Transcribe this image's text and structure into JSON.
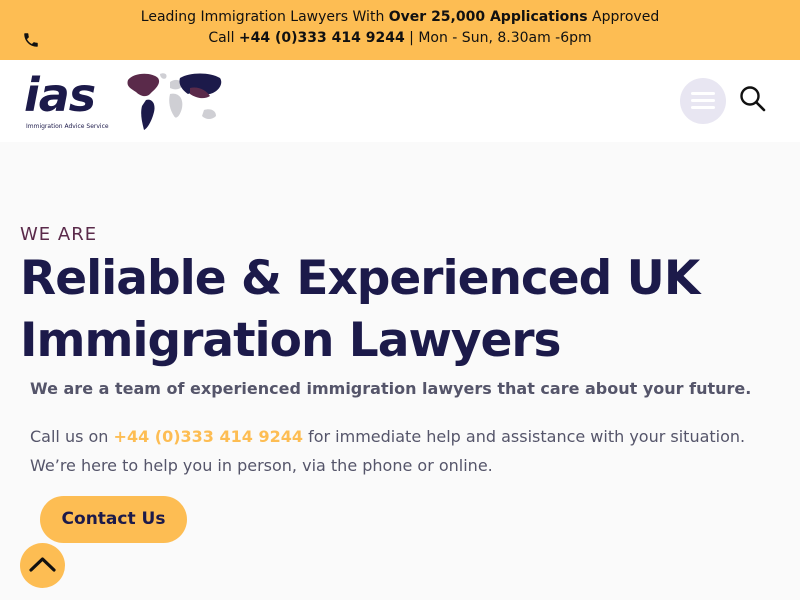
{
  "topbar": {
    "line1_prefix": "Leading Immigration Lawyers With ",
    "line1_bold": "Over 25,000 Applications",
    "line1_suffix": " Approved",
    "line2_prefix": "Call ",
    "line2_phone": "+44 (0)333 414 9244",
    "line2_suffix": " | Mon - Sun, 8.30am -6pm",
    "icon": "phone-icon"
  },
  "header": {
    "logo_text": "ias",
    "logo_subtitle": "Immigration Advice Service",
    "map_icon": "world-map-icon",
    "menu_icon": "hamburger-menu-icon",
    "search_icon": "search-icon"
  },
  "hero": {
    "eyebrow": "WE ARE",
    "headline": "Reliable & Experienced UK Immigration Lawyers",
    "subhead": "We are a team of experienced immigration lawyers that care about your future.",
    "body_prefix": "Call us on ",
    "body_phone": "+44 (0)333 414 9244",
    "body_suffix": " for immediate help and assistance with your situation. We’re here to help you in person, via the phone or online.",
    "cta_label": "Contact Us",
    "scroll_top_icon": "chevron-up-icon"
  },
  "colors": {
    "accent": "#fdbd53",
    "brand_navy": "#1c1a4a",
    "brand_plum": "#5a2a4a",
    "text_muted": "#55556a"
  }
}
